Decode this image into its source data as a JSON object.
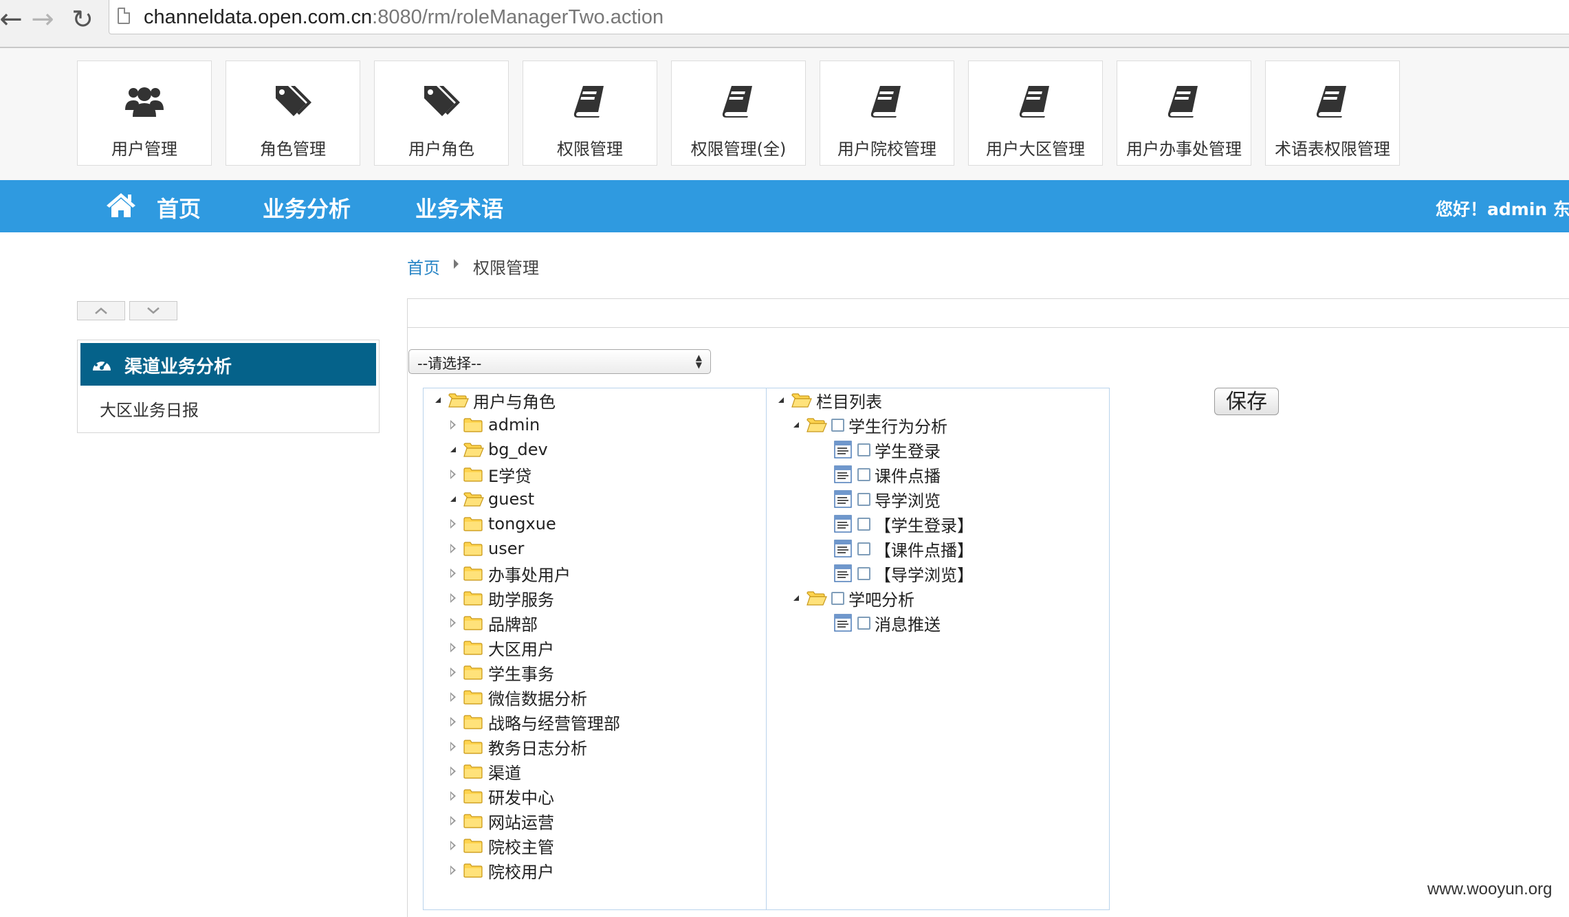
{
  "browser": {
    "url_host": "channeldata.open.com.cn",
    "url_path": ":8080/rm/roleManagerTwo.action"
  },
  "tiles": [
    {
      "label": "用户管理",
      "icon": "users-icon"
    },
    {
      "label": "角色管理",
      "icon": "tags-icon"
    },
    {
      "label": "用户角色",
      "icon": "tags-icon"
    },
    {
      "label": "权限管理",
      "icon": "book-icon"
    },
    {
      "label": "权限管理(全)",
      "icon": "book-icon"
    },
    {
      "label": "用户院校管理",
      "icon": "book-icon"
    },
    {
      "label": "用户大区管理",
      "icon": "book-icon"
    },
    {
      "label": "用户办事处管理",
      "icon": "book-icon"
    },
    {
      "label": "术语表权限管理",
      "icon": "book-icon"
    }
  ],
  "nav": {
    "home": "首页",
    "analysis": "业务分析",
    "terms": "业务术语",
    "greeting": "您好！admin  东北"
  },
  "breadcrumb": {
    "home": "首页",
    "current": "权限管理"
  },
  "sidebar": {
    "active": "渠道业务分析",
    "items": [
      "大区业务日报"
    ]
  },
  "form": {
    "select_value": "--请选择--",
    "save_label": "保存"
  },
  "role_tree": {
    "root": "用户与角色",
    "nodes": [
      {
        "label": "admin",
        "expanded": false
      },
      {
        "label": "bg_dev",
        "expanded": true
      },
      {
        "label": "E学贷",
        "expanded": false
      },
      {
        "label": "guest",
        "expanded": true
      },
      {
        "label": "tongxue",
        "expanded": false
      },
      {
        "label": "user",
        "expanded": false
      },
      {
        "label": "办事处用户",
        "expanded": false
      },
      {
        "label": "助学服务",
        "expanded": false
      },
      {
        "label": "品牌部",
        "expanded": false
      },
      {
        "label": "大区用户",
        "expanded": false
      },
      {
        "label": "学生事务",
        "expanded": false
      },
      {
        "label": "微信数据分析",
        "expanded": false
      },
      {
        "label": "战略与经营管理部",
        "expanded": false
      },
      {
        "label": "教务日志分析",
        "expanded": false
      },
      {
        "label": "渠道",
        "expanded": false
      },
      {
        "label": "研发中心",
        "expanded": false
      },
      {
        "label": "网站运营",
        "expanded": false
      },
      {
        "label": "院校主管",
        "expanded": false
      },
      {
        "label": "院校用户",
        "expanded": false
      }
    ]
  },
  "column_tree": {
    "root": "栏目列表",
    "groups": [
      {
        "label": "学生行为分析",
        "children": [
          "学生登录",
          "课件点播",
          "导学浏览",
          "【学生登录】",
          "【课件点播】",
          "【导学浏览】"
        ]
      },
      {
        "label": "学吧分析",
        "children": [
          "消息推送"
        ]
      }
    ]
  },
  "footer": {
    "watermark": "www.wooyun.org"
  },
  "colors": {
    "nav_blue": "#2f9ae0",
    "sidebar_active": "#05628a",
    "link": "#2a86c6"
  }
}
